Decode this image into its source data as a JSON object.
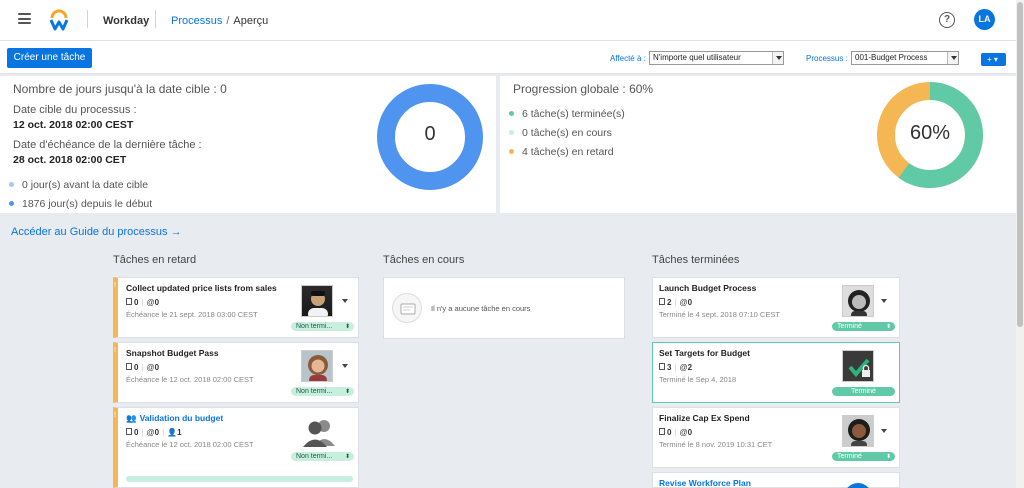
{
  "header": {
    "app_name": "Workday",
    "breadcrumb_link": "Processus",
    "breadcrumb_sep": "/",
    "breadcrumb_current": "Aperçu",
    "help_glyph": "?",
    "user_initials": "LA",
    "brand_color": "#0875e1"
  },
  "toolbar": {
    "create_label": "Créer une tâche",
    "assigned_label": "Affecté à :",
    "assigned_value": "N'importe quel utilisateur",
    "process_label": "Processus :",
    "process_value": "001-Budget Process",
    "add_label": "+ ▾"
  },
  "left_panel": {
    "title": "Nombre de jours jusqu'à la date cible : 0",
    "target_label": "Date cible du processus :",
    "target_value": "12 oct. 2018 02:00 CEST",
    "due_label": "Date d'échéance de la dernière tâche :",
    "due_value": "28 oct. 2018 02:00 CET",
    "legend": [
      {
        "text": "0 jour(s) avant la date cible",
        "color": "#a8c8ef"
      },
      {
        "text": "1876 jour(s) depuis le début",
        "color": "#4f95f0"
      }
    ],
    "donut_label": "0",
    "donut_color": "#4f95f0",
    "donut_fraction": 1.0
  },
  "right_panel": {
    "title": "Progression globale : 60%",
    "legend": [
      {
        "text": "6 tâche(s) terminée(s)",
        "color": "#5fcaa5"
      },
      {
        "text": "0 tâche(s) en cours",
        "color": "#c8eee0"
      },
      {
        "text": "4 tâche(s) en retard",
        "color": "#f4b754"
      }
    ],
    "donut_label": "60%",
    "done_fraction": 0.6,
    "done_color": "#5fcaa5",
    "late_color": "#f4b754"
  },
  "guide_link": "Accéder au Guide du processus →",
  "columns": {
    "late": "Tâches en retard",
    "in_progress": "Tâches en cours",
    "done": "Tâches terminées"
  },
  "late_tasks": [
    {
      "title": "Collect updated price lists from sales",
      "docs": "0",
      "comments": "0",
      "due": "Échéance le 21 sept. 2018 03:00 CEST",
      "status": "Non termi..."
    },
    {
      "title": "Snapshot Budget Pass",
      "docs": "0",
      "comments": "0",
      "due": "Échéance le 12 oct. 2018 02:00 CEST",
      "status": "Non termi..."
    },
    {
      "title": "Validation du budget",
      "docs": "0",
      "comments": "0",
      "people": "1",
      "due": "Échéance le 12 oct. 2018 02:00 CEST",
      "status": "Non termi..."
    }
  ],
  "in_progress_empty": "Il n'y a aucune tâche en cours",
  "done_tasks": [
    {
      "title": "Launch Budget Process",
      "docs": "2",
      "comments": "0",
      "due": "Terminé le 4 sept. 2018 07:10 CEST",
      "status": "Terminé"
    },
    {
      "title": "Set Targets for Budget",
      "docs": "3",
      "comments": "2",
      "due": "Terminé le Sep 4, 2018",
      "status": "Terminé"
    },
    {
      "title": "Finalize Cap Ex Spend",
      "docs": "0",
      "comments": "0",
      "due": "Terminé le 8 nov. 2019 10:31 CET",
      "status": "Terminé"
    },
    {
      "title": "Revise Workforce Plan"
    }
  ]
}
